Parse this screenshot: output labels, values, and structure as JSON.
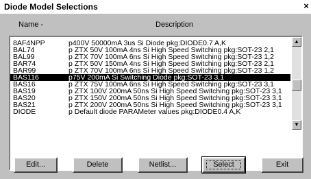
{
  "window": {
    "title": "Diode Model Selections",
    "close_glyph": "×"
  },
  "header": {
    "name": "Name -",
    "description": "Description"
  },
  "rows": [
    {
      "name": "8AF4NPP",
      "desc": "p400V 50000mA 3us Si Diode pkg:DIODE0.7 A,K"
    },
    {
      "name": "BAL74",
      "desc": "p ZTX 50V 100mA 4ns Si High Speed Switching pkg:SOT-23 2,1"
    },
    {
      "name": "BAL99",
      "desc": "p ZTX 70V 100mA 6ns Si High Speed Switching pkg:SOT-23 1,2"
    },
    {
      "name": "BAR74",
      "desc": "p ZTX 50V 150mA 4ns Si High Speed Switching pkg:SOT-23 2,1"
    },
    {
      "name": "BAR99",
      "desc": "p ZTX 70V 100mA 6ns Si High Speed Switching pkg:SOT-23 1,2"
    },
    {
      "name": "BAS116",
      "desc": "p75V 200mA Si Switching Diode pkg:SOT-23 3,1"
    },
    {
      "name": "BAS16",
      "desc": "p ZTX 75V 100mA 6ns Si High Speed Switching pkg:SOT-23 3,1"
    },
    {
      "name": "BAS19",
      "desc": "p ZTX 100V 200mA 50ns Si High Speed Switching pkg:SOT-23 3,1"
    },
    {
      "name": "BAS20",
      "desc": "p ZTX 150V 200mA 50ns Si High Speed Switching pkg:SOT-23 3,1"
    },
    {
      "name": "BAS21",
      "desc": "p ZTX 200V 200mA 50ns Si High Speed Switching pkg:SOT-23 3,1"
    },
    {
      "name": "DIODE",
      "desc": "p Default diode PARAMeter values pkg:DIODE0.4 A,K"
    }
  ],
  "selected_index": 5,
  "scrollbar": {
    "up_glyph": "▲",
    "down_glyph": "▼"
  },
  "buttons": {
    "edit": "Edit...",
    "delete": "Delete",
    "netlist": "Netlist...",
    "select": "Select",
    "exit": "Exit"
  }
}
